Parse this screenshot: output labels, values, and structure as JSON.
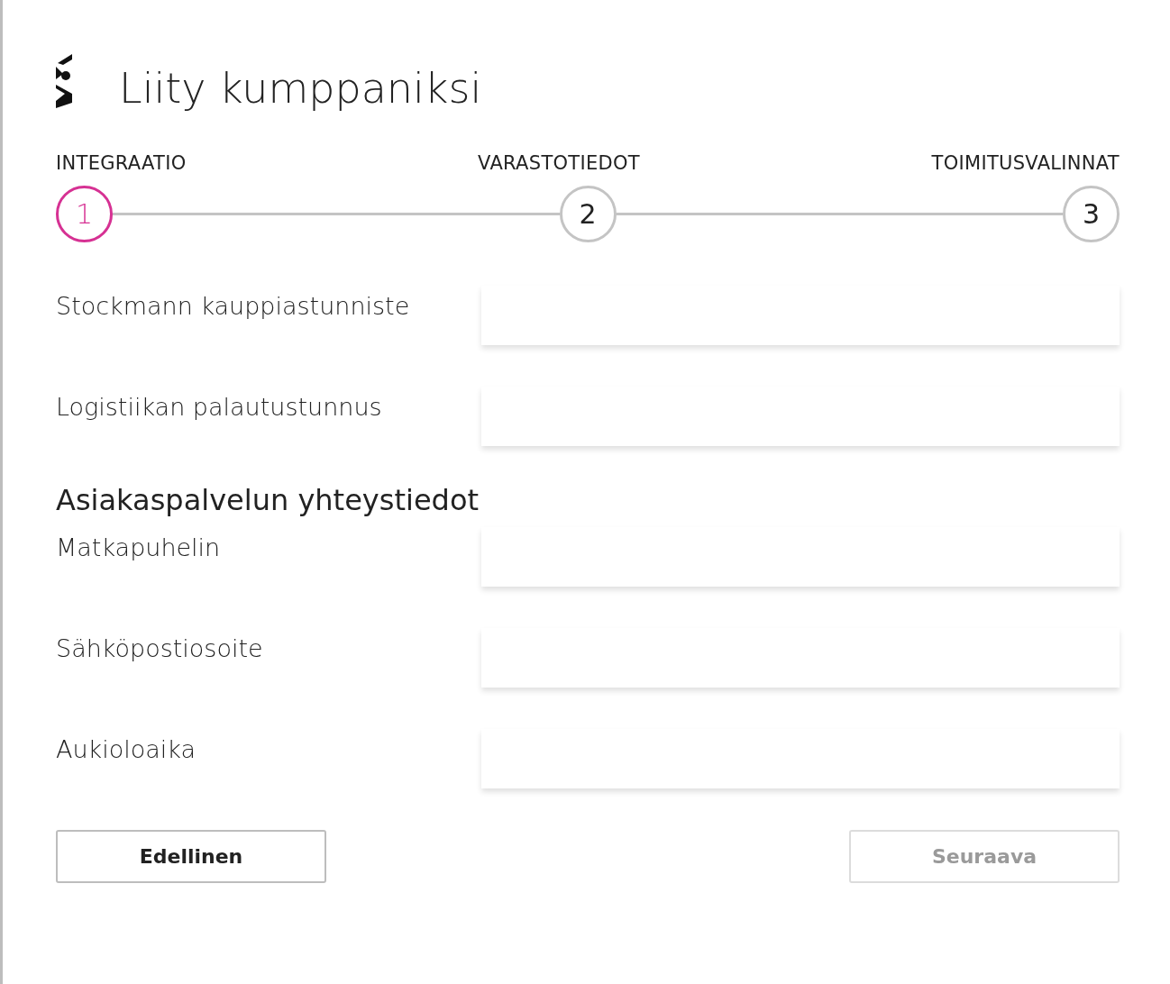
{
  "title": "Liity kumppaniksi",
  "steps": [
    {
      "label": "INTEGRAATIO",
      "number": "1",
      "selected": true
    },
    {
      "label": "VARASTOTIEDOT",
      "number": "2",
      "selected": false
    },
    {
      "label": "TOIMITUSVALINNAT",
      "number": "3",
      "selected": false
    }
  ],
  "form": [
    {
      "kind": "input",
      "label": "Stockmann kauppiastunniste"
    },
    {
      "kind": "input",
      "label": "Logistiikan palautustunnus"
    },
    {
      "kind": "heading",
      "label": "Asiakaspalvelun yhteystiedot"
    },
    {
      "kind": "input",
      "label": "Matkapuhelin"
    },
    {
      "kind": "input",
      "label": "Sähköpostiosoite"
    },
    {
      "kind": "input",
      "label": "Aukioloaika"
    }
  ],
  "buttons": [
    {
      "label": "Edellinen",
      "disabled": false
    },
    {
      "label": "Seuraava",
      "disabled": true
    }
  ]
}
